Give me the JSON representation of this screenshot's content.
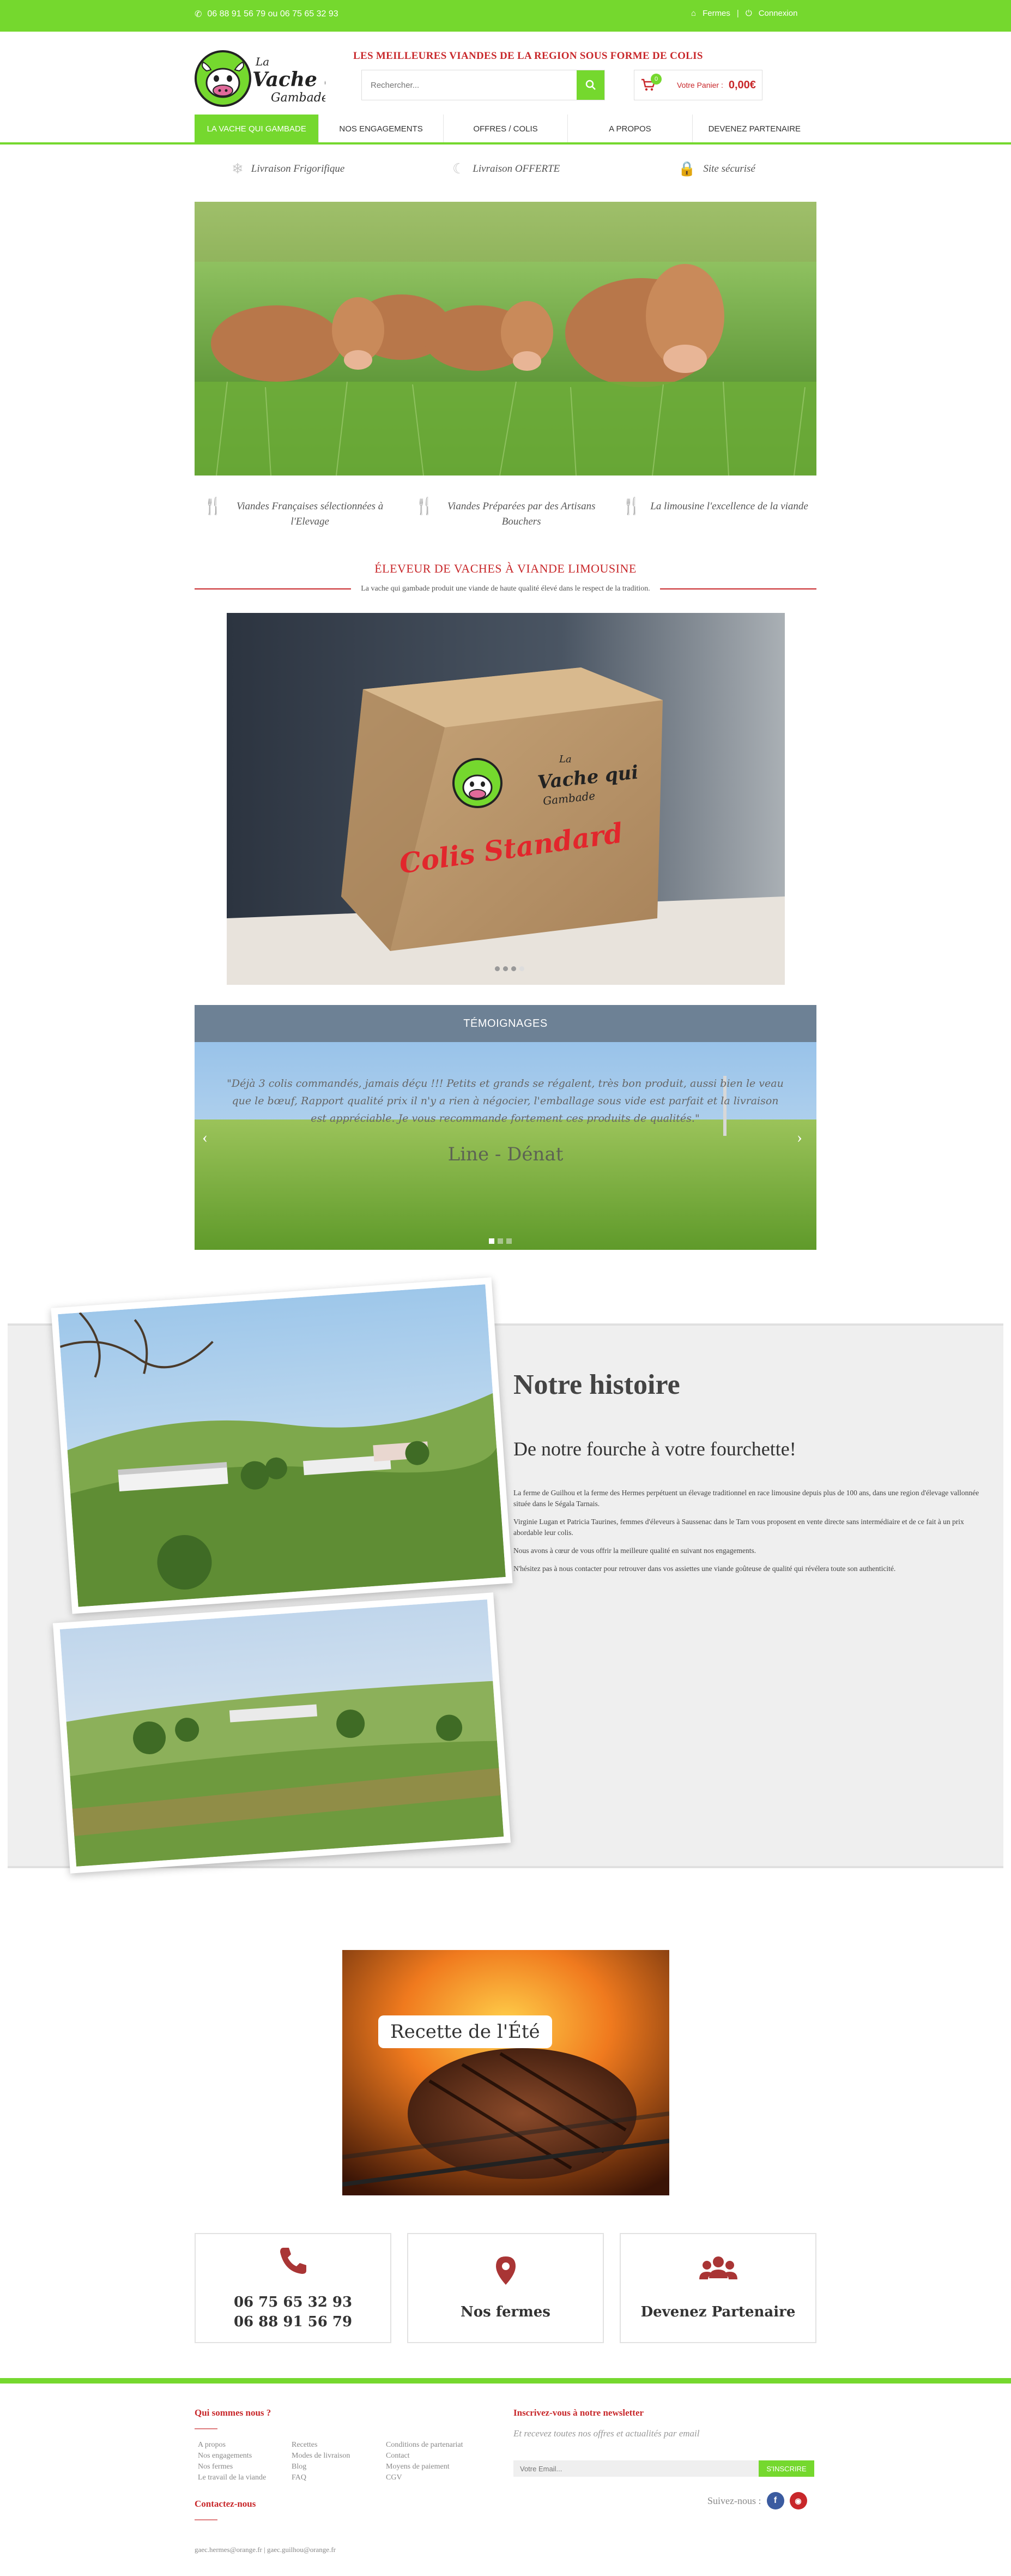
{
  "topbar": {
    "phone": "06 88 91 56 79 ou 06 75 65 32 93",
    "fermes": "Fermes",
    "connexion": "Connexion"
  },
  "header": {
    "tagline": "LES MEILLEURES VIANDES DE LA REGION SOUS FORME DE COLIS",
    "search_placeholder": "Rechercher...",
    "cart_count": "0",
    "cart_label": "Votre Panier :",
    "cart_amount": "0,00€"
  },
  "nav": {
    "items": [
      "LA VACHE QUI GAMBADE",
      "NOS ENGAGEMENTS",
      "OFFRES / COLIS",
      "A PROPOS",
      "DEVENEZ PARTENAIRE"
    ]
  },
  "features": [
    "Livraison Frigorifique",
    "Livraison OFFERTE",
    "Site sécurisé"
  ],
  "features2": [
    "Viandes Françaises sélectionnées à l'Elevage",
    "Viandes Préparées par des Artisans Bouchers",
    "La limousine l'excellence de la viande"
  ],
  "eleveur": {
    "title": "ÉLEVEUR DE VACHES À VIANDE LIMOUSINE",
    "subtitle": "La vache qui gambade produit une viande de haute qualité élevé dans le respect de la tradition."
  },
  "colis": {
    "logo_top": "La",
    "logo_main": "Vache qui",
    "logo_sub": "Gambade",
    "label": "Colis Standard"
  },
  "testimonials": {
    "title": "TÉMOIGNAGES",
    "quote": "\"Déjà 3 colis commandés, jamais déçu !!! Petits et grands se régalent, très bon produit, aussi bien le veau que le bœuf, Rapport qualité prix il n'y a rien à négocier, l'emballage sous vide est parfait et la livraison est appréciable. Je vous recommande fortement ces produits de qualités.\"",
    "author": "Line - Dénat"
  },
  "histoire": {
    "title": "Notre histoire",
    "subtitle": "De notre fourche à votre fourchette!",
    "paragraphs": [
      "La ferme de Guilhou et la ferme des Hermes perpétuent un élevage traditionnel en race limousine depuis plus de 100 ans, dans une region d'élevage vallonnée située dans le Ségala Tarnais.",
      "Virginie Lugan et Patricia Taurines, femmes d'éleveurs à Saussenac dans le Tarn vous proposent en vente directe sans intermédiaire et de ce fait à un prix abordable leur colis.",
      "Nous avons à cœur de vous offrir la meilleure qualité en suivant nos engagements.",
      "N'hésitez pas à nous contacter pour retrouver dans vos assiettes une viande goûteuse de qualité qui révélera toute son authenticité."
    ]
  },
  "recette": {
    "label": "Recette de l'Été"
  },
  "contact_boxes": {
    "phone1": "06 75 65 32 93",
    "phone2": "06 88 91 56 79",
    "fermes": "Nos fermes",
    "partenaire": "Devenez Partenaire"
  },
  "footer": {
    "qui_title": "Qui sommes nous ?",
    "col1": [
      "A propos",
      "Nos engagements",
      "Nos fermes",
      "Le travail de la viande"
    ],
    "col2": [
      "Recettes",
      "Modes de livraison",
      "Blog",
      "FAQ"
    ],
    "col3": [
      "Conditions de partenariat",
      "Contact",
      "Moyens de paiement",
      "CGV"
    ],
    "contact_title": "Contactez-nous",
    "emails": "gaec.hermes@orange.fr | gaec.guilhou@orange.fr",
    "newsletter_title": "Inscrivez-vous à notre newsletter",
    "newsletter_sub": "Et recevez toutes nos offres et actualités par email",
    "email_placeholder": "Votre Email...",
    "subscribe": "S'INSCRIRE",
    "follow": "Suivez-nous :"
  },
  "colors": {
    "green": "#75d82e",
    "red": "#c8272a",
    "testimonial_header": "#6d8195"
  }
}
